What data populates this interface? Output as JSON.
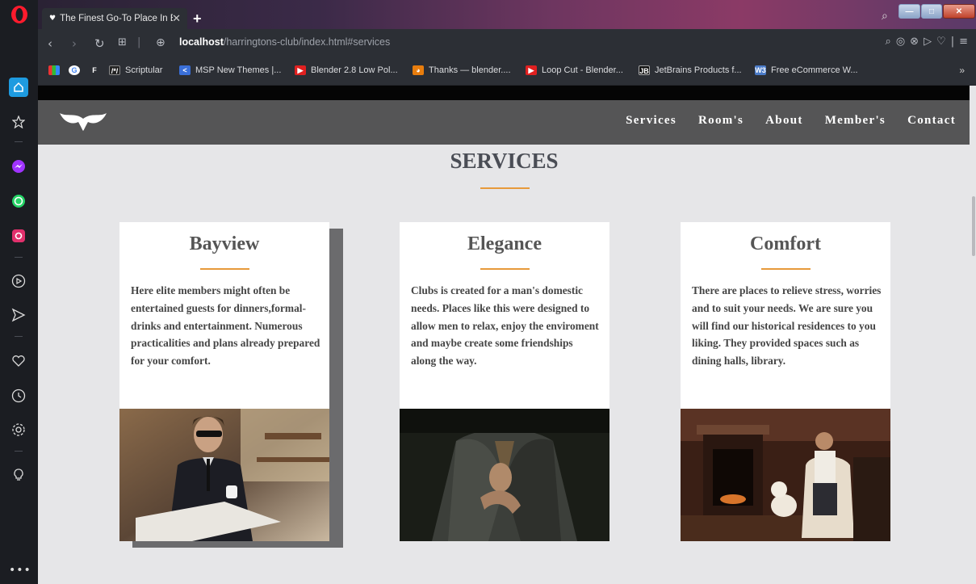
{
  "browser": {
    "tab_title": "The Finest Go-To Place In E",
    "tab_close": "✕",
    "new_tab": "+",
    "url_host": "localhost",
    "url_path": "/harringtons-club/index.html#services"
  },
  "bookmarks": [
    {
      "label": "Scriptular",
      "icon": "scriptular-icon",
      "color": "#222"
    },
    {
      "label": "MSP New Themes |...",
      "icon": "msp-icon",
      "color": "#3a6fd8"
    },
    {
      "label": "Blender 2.8 Low Pol...",
      "icon": "youtube-icon",
      "color": "#e02020"
    },
    {
      "label": "Thanks — blender....",
      "icon": "blender-icon",
      "color": "#e87d0d"
    },
    {
      "label": "Loop Cut - Blender...",
      "icon": "youtube-icon",
      "color": "#e02020"
    },
    {
      "label": "JetBrains Products f...",
      "icon": "jetbrains-icon",
      "color": "#111"
    },
    {
      "label": "Free eCommerce W...",
      "icon": "w3-icon",
      "color": "#4a7bc8"
    }
  ],
  "site": {
    "nav": [
      "Services",
      "Room's",
      "About",
      "Member's",
      "Contact"
    ],
    "section_title": "SERVICES",
    "accent": "#e79a3b",
    "cards": [
      {
        "title": "Bayview",
        "text": "Here elite members might often be entertained guests for dinners,formal-drinks and entertainment. Numerous practicalities and plans already prepared for your comfort."
      },
      {
        "title": "Elegance",
        "text": "Clubs is created for a man's domestic needs. Places like this were designed to allow men to relax, enjoy the enviroment and maybe create some friendships along the way."
      },
      {
        "title": "Comfort",
        "text": "There are places to relieve stress, worries and to suit your needs. We are sure you will find our historical residences to you liking. They provided spaces such as dining halls, library."
      }
    ]
  }
}
